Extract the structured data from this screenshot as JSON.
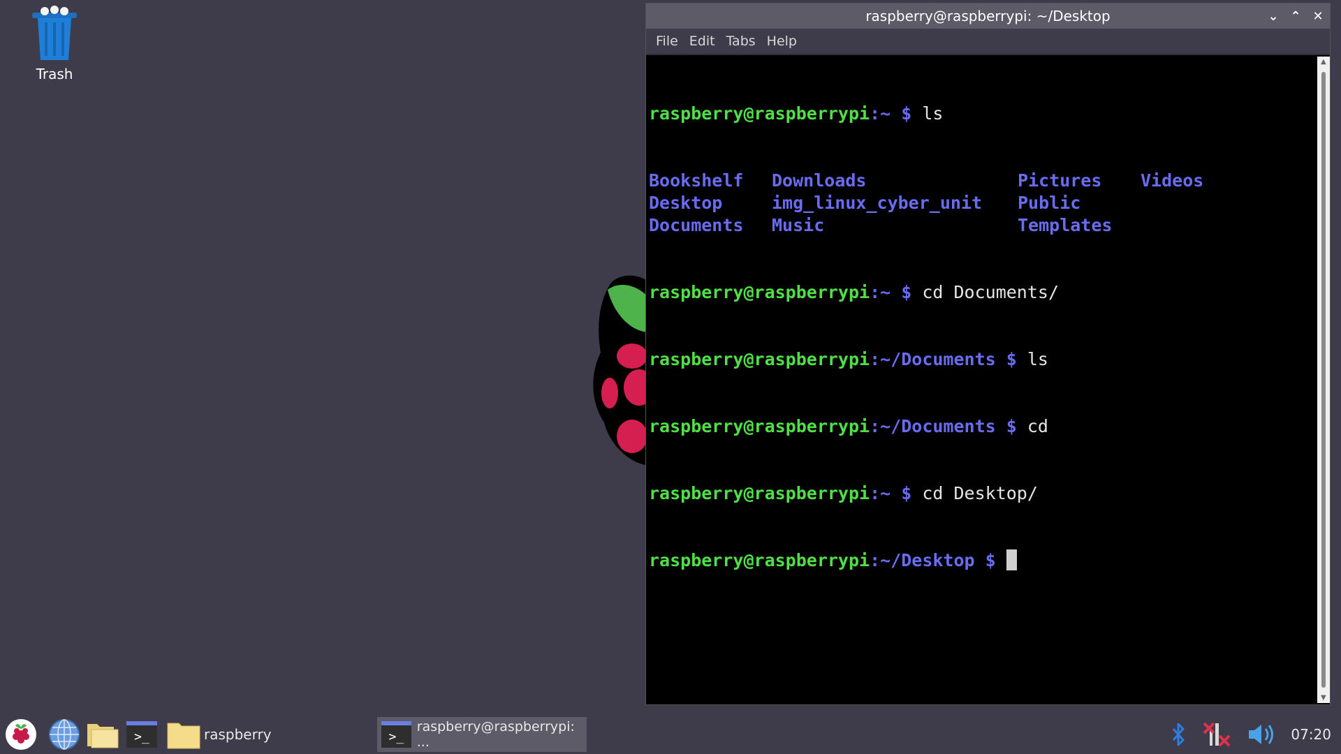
{
  "desktop": {
    "trash_label": "Trash"
  },
  "window": {
    "title": "raspberry@raspberrypi: ~/Desktop",
    "menu": [
      "File",
      "Edit",
      "Tabs",
      "Help"
    ]
  },
  "terminal": {
    "user_host": "raspberry@raspberrypi",
    "lines": [
      {
        "path": ":~",
        "prompt": " $ ",
        "cmd": "ls"
      },
      {
        "path": ":~",
        "prompt": " $ ",
        "cmd": "cd Documents/"
      },
      {
        "path": ":~/Documents",
        "prompt": " $ ",
        "cmd": "ls"
      },
      {
        "path": ":~/Documents",
        "prompt": " $ ",
        "cmd": "cd"
      },
      {
        "path": ":~",
        "prompt": " $ ",
        "cmd": "cd Desktop/"
      },
      {
        "path": ":~/Desktop",
        "prompt": " $ ",
        "cmd": ""
      }
    ],
    "ls_output": [
      "Bookshelf",
      "Downloads",
      "Pictures",
      "Videos",
      "Desktop",
      "img_linux_cyber_unit",
      "Public",
      "",
      "Documents",
      "Music",
      "Templates",
      ""
    ]
  },
  "taskbar": {
    "folder_label": "raspberry",
    "task_label": "raspberry@raspberrypi: ...",
    "clock": "07:20"
  },
  "colors": {
    "desktop_bg": "#3e3c4a",
    "prompt_user": "#4fe046",
    "prompt_path": "#6a6cf0"
  }
}
